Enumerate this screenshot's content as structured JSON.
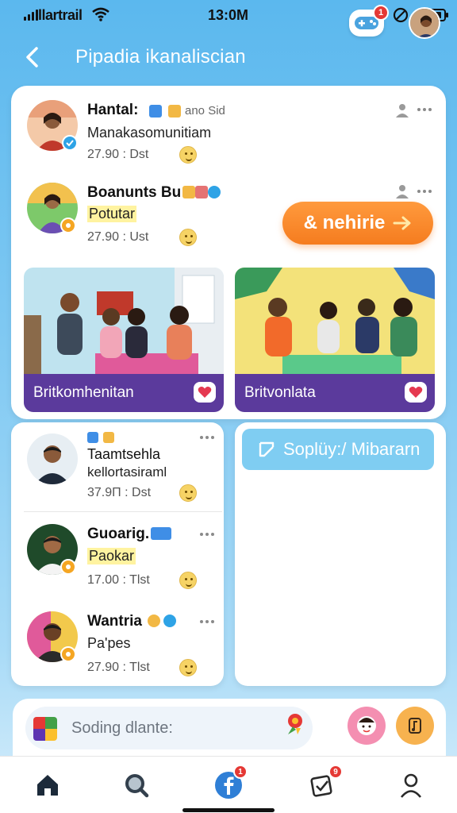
{
  "status_bar": {
    "carrier": "llartrail",
    "time": "13:0M"
  },
  "header": {
    "title": "Pipadia ikanaliscian",
    "game_badge": "1"
  },
  "posts": [
    {
      "name": "Hantal:",
      "tag": "ano Sid",
      "subtitle": "Manakasomunitiam",
      "meta": "27.90 : Dst"
    },
    {
      "name": "Boanunts Bu",
      "subtitle": "Potutar",
      "meta": "27.90 : Ust"
    }
  ],
  "cta": {
    "label": "& nehirie"
  },
  "photos": [
    {
      "caption": "Britkomhenitan"
    },
    {
      "caption": "Britvonlata"
    }
  ],
  "list_posts": [
    {
      "name": "Taamtsehla",
      "subtitle": "kellortasiraml",
      "meta": "37.9Π : Dst"
    },
    {
      "name": "Guoarig.",
      "subtitle": "Paokar",
      "meta": "17.00 : Tlst"
    },
    {
      "name": "Wantria",
      "subtitle": "Pa'pes",
      "meta": "27.90 : Tlst"
    }
  ],
  "apply": {
    "label": "Soplüy:/ Mibararn"
  },
  "compose": {
    "placeholder": "Soding dlante:"
  },
  "tabs": {
    "home": "home",
    "search": "search",
    "feed_badge": "1",
    "tasks_badge": "9",
    "profile": "profile"
  },
  "colors": {
    "accent_orange": "#f57c1f",
    "caption_purple": "#5b3a9c",
    "sky_blue": "#5bb8ee",
    "badge_red": "#e53935"
  }
}
